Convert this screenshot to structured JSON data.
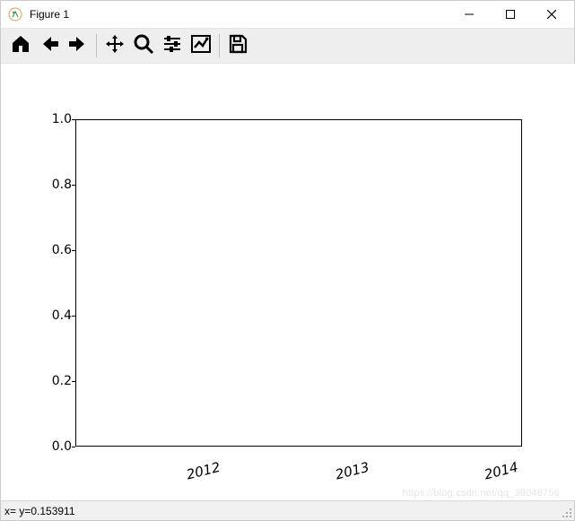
{
  "window": {
    "title": "Figure 1"
  },
  "toolbar": {
    "home": "home-icon",
    "back": "back-icon",
    "forward": "forward-icon",
    "pan": "pan-icon",
    "zoom": "zoom-icon",
    "configure": "configure-icon",
    "edit": "edit-icon",
    "save": "save-icon"
  },
  "statusbar": {
    "coords": "x= y=0.153911"
  },
  "watermark": "https://blog.csdn.net/qq_38048756",
  "chart_data": {
    "type": "line",
    "series": [],
    "x_ticks": [
      "2012",
      "2013",
      "2014"
    ],
    "y_ticks": [
      "0.0",
      "0.2",
      "0.4",
      "0.6",
      "0.8",
      "1.0"
    ],
    "xlim": [
      2011,
      2014
    ],
    "ylim": [
      0.0,
      1.0
    ],
    "title": "",
    "xlabel": "",
    "ylabel": "",
    "x_tick_rotation": -14,
    "x_tick_style": "italic"
  }
}
